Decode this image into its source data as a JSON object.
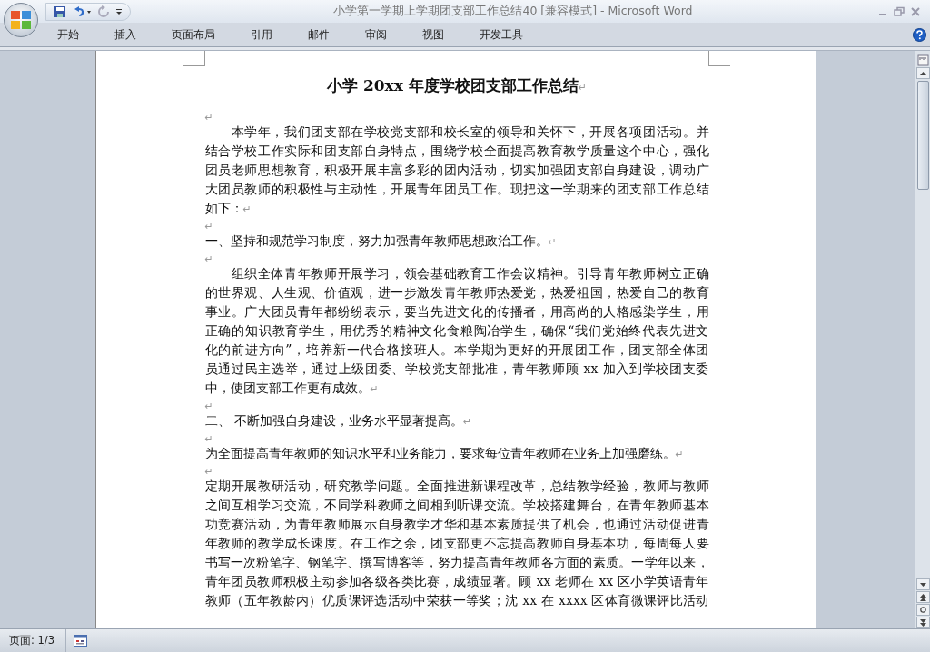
{
  "window": {
    "title": "小学第一学期上学期团支部工作总结40 [兼容模式] - Microsoft Word"
  },
  "ribbon_tabs": [
    {
      "label": "开始",
      "selected": false
    },
    {
      "label": "插入",
      "selected": false
    },
    {
      "label": "页面布局",
      "selected": false
    },
    {
      "label": "引用",
      "selected": false
    },
    {
      "label": "邮件",
      "selected": false
    },
    {
      "label": "审阅",
      "selected": false
    },
    {
      "label": "视图",
      "selected": false
    },
    {
      "label": "开发工具",
      "selected": false
    }
  ],
  "document": {
    "title": "小学 20xx 年度学校团支部工作总结",
    "title_mark": "↵",
    "paragraphs": [
      {
        "mark": "↵"
      },
      {
        "indent": true,
        "lines": [
          "本学年，我们团支部在学校党支部和校长室的领导和关怀下，开展各项团活动。并",
          "结合学校工作实际和团支部自身特点，围绕学校全面提高教育教学质量这个中心，强化",
          "团员老师思想教育，积极开展丰富多彩的团内活动，切实加强团支部自身建设，调动广",
          "大团员教师的积极性与主动性，开展青年团员工作。现把这一学期来的团支部工作总结",
          "如下："
        ],
        "mark": "↵"
      },
      {
        "mark": "↵"
      },
      {
        "lines": [
          "一、坚持和规范学习制度，努力加强青年教师思想政治工作。"
        ],
        "mark": "↵"
      },
      {
        "mark": "↵"
      },
      {
        "indent": true,
        "lines": [
          "组织全体青年教师开展学习，领会基础教育工作会议精神。引导青年教师树立正确",
          "的世界观、人生观、价值观，进一步激发青年教师热爱党，热爱祖国，热爱自己的教育",
          "事业。广大团员青年都纷纷表示，要当先进文化的传播者，用高尚的人格感染学生，用",
          "正确的知识教育学生，用优秀的精神文化食粮陶冶学生，确保“我们党始终代表先进文",
          "化的前进方向”，培养新一代合格接班人。本学期为更好的开展团工作，团支部全体团",
          "员通过民主选举，通过上级团委、学校党支部批准，青年教师顾 xx 加入到学校团支委",
          "中，使团支部工作更有成效。"
        ],
        "mark": "↵"
      },
      {
        "mark": "↵"
      },
      {
        "lines": [
          "二、 不断加强自身建设，业务水平显著提高。"
        ],
        "mark": "↵"
      },
      {
        "mark": "↵"
      },
      {
        "lines": [
          "为全面提高青年教师的知识水平和业务能力，要求每位青年教师在业务上加强磨练。"
        ],
        "mark": "↵"
      },
      {
        "mark": "↵"
      },
      {
        "lines": [
          "定期开展教研活动，研究教学问题。全面推进新课程改革，总结教学经验，教师与教师",
          "之间互相学习交流，不同学科教师之间相到听课交流。学校搭建舞台，在青年教师基本",
          "功竞赛活动，为青年教师展示自身教学才华和基本素质提供了机会，也通过活动促进青",
          "年教师的教学成长速度。在工作之余，团支部更不忘提高教师自身基本功，每周每人要",
          "书写一次粉笔字、钢笔字、撰写博客等，努力提高青年教师各方面的素质。一学年以来，",
          "青年团员教师积极主动参加各级各类比赛，成绩显著。顾 xx 老师在 xx 区小学英语青年",
          "教师（五年教龄内）优质课评选活动中荣获一等奖；沈 xx 在 xxxx 区体育微课评比活动"
        ]
      }
    ]
  },
  "status_bar": {
    "page": "页面: 1/3"
  }
}
